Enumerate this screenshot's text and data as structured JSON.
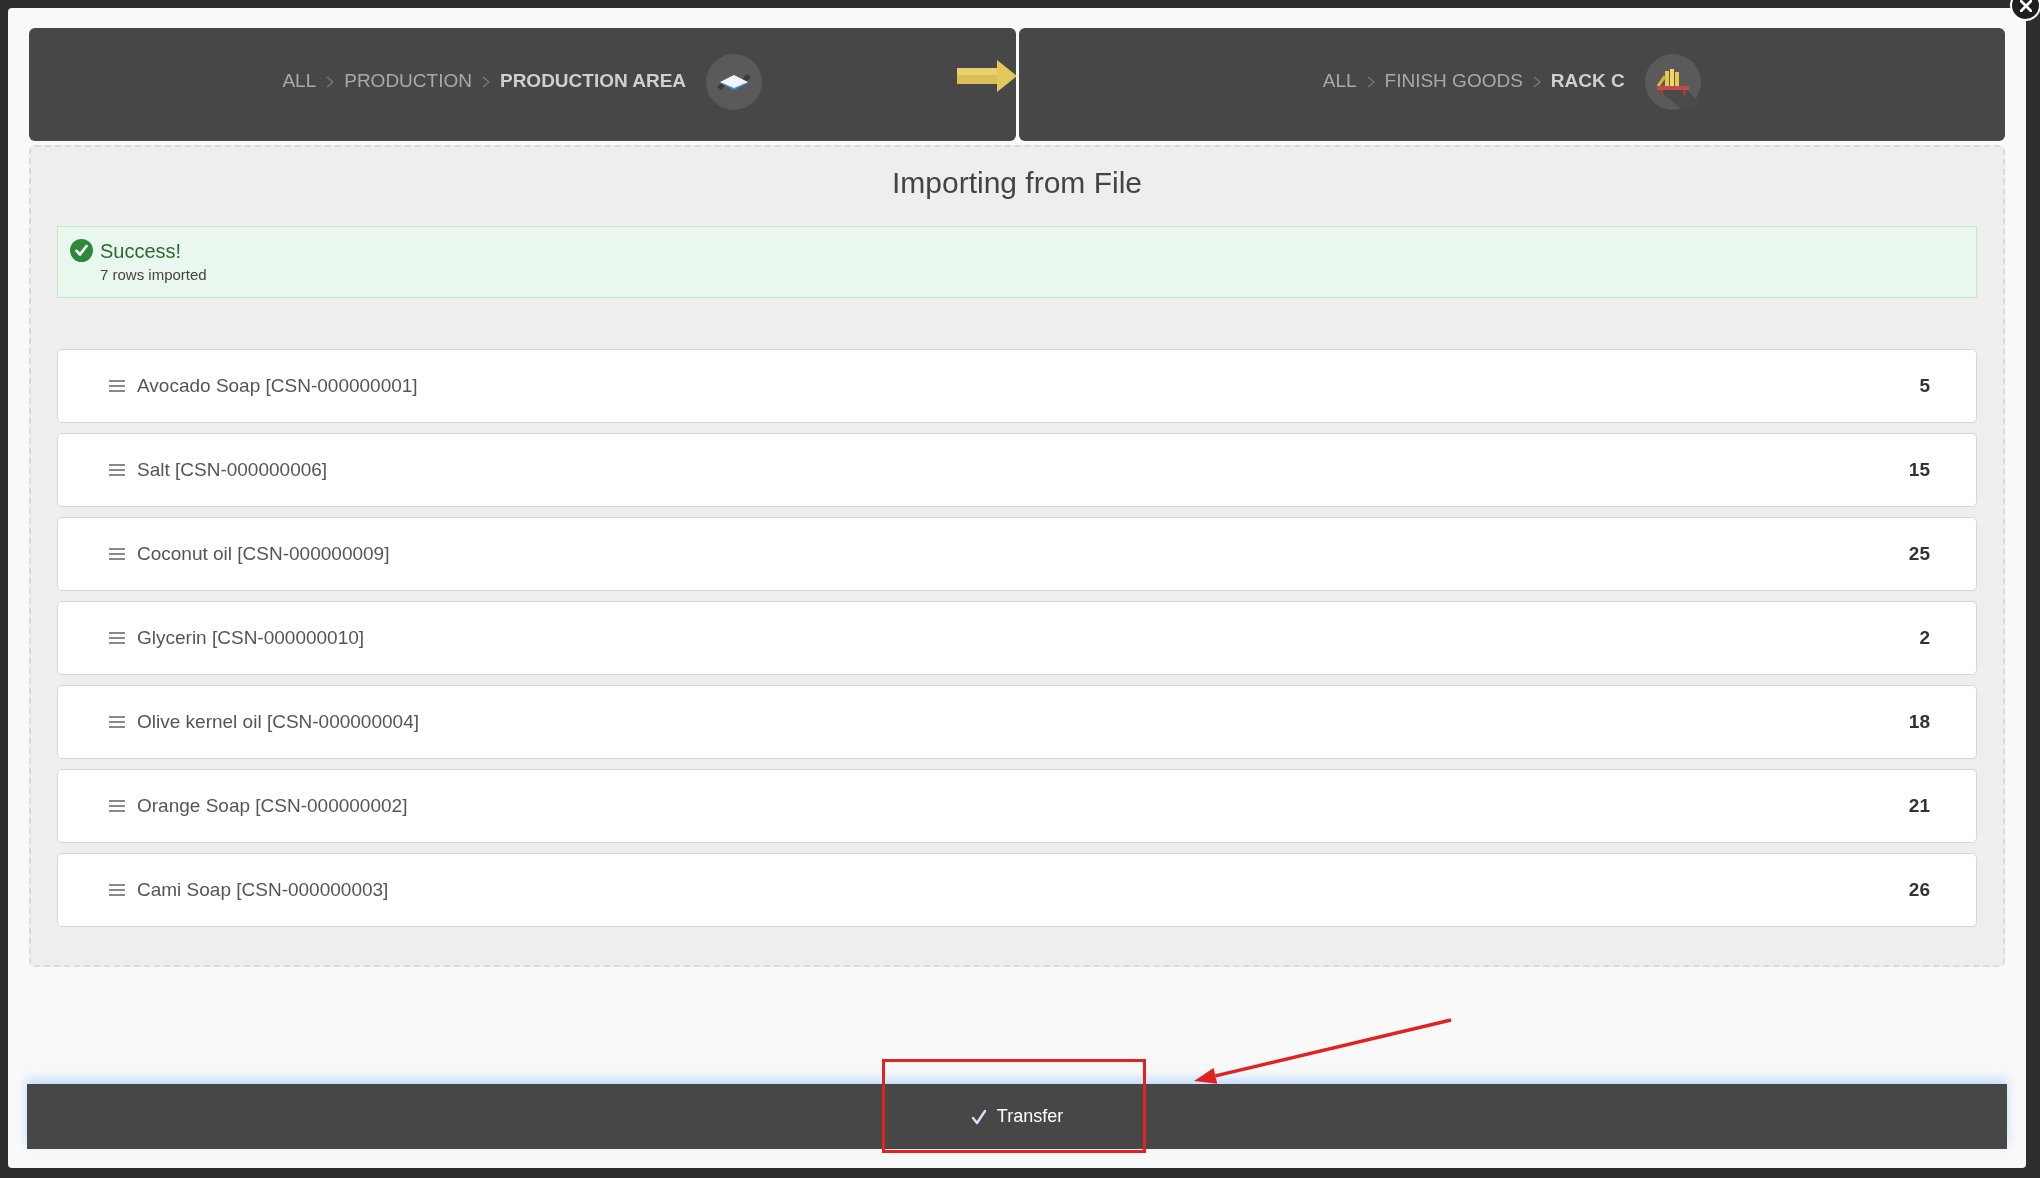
{
  "transfer": {
    "from": {
      "kind": "area",
      "path": [
        {
          "label": "ALL",
          "current": false
        },
        {
          "label": "PRODUCTION",
          "current": false
        },
        {
          "label": "PRODUCTION AREA",
          "current": true
        }
      ]
    },
    "to": {
      "kind": "rack",
      "path": [
        {
          "label": "ALL",
          "current": false
        },
        {
          "label": "FINISH GOODS",
          "current": false
        },
        {
          "label": "RACK C",
          "current": true
        }
      ]
    }
  },
  "title": "Importing from File",
  "alert": {
    "kind": "success",
    "title": "Success!",
    "message": "7 rows imported"
  },
  "items": [
    {
      "name": "Avocado Soap [CSN-000000001]",
      "quantity": "5"
    },
    {
      "name": "Salt [CSN-000000006]",
      "quantity": "15"
    },
    {
      "name": "Coconut oil [CSN-000000009]",
      "quantity": "25"
    },
    {
      "name": "Glycerin [CSN-000000010]",
      "quantity": "2"
    },
    {
      "name": "Olive kernel oil [CSN-000000004]",
      "quantity": "18"
    },
    {
      "name": "Orange Soap [CSN-000000002]",
      "quantity": "21"
    },
    {
      "name": "Cami Soap [CSN-000000003]",
      "quantity": "26"
    }
  ],
  "footer": {
    "button": {
      "label": "Transfer"
    }
  },
  "annotations": {
    "highlight_box": true,
    "arrow": true
  }
}
